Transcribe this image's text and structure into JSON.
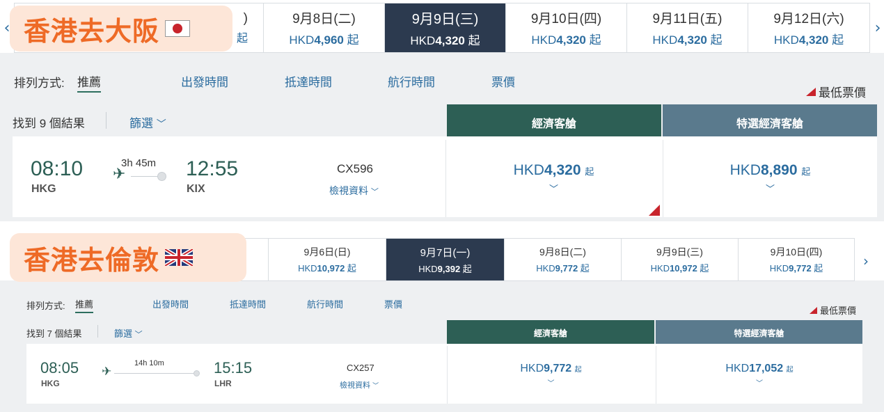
{
  "panel1": {
    "title": "香港去大阪",
    "flag_icon": "japan-flag-icon",
    "partial_date": ")",
    "partial_price": "起",
    "dates": [
      {
        "date": "9月8日(二)",
        "currency": "HKD",
        "price": "4,960",
        "suffix": " 起",
        "active": false
      },
      {
        "date": "9月9日(三)",
        "currency": "HKD",
        "price": "4,320",
        "suffix": " 起",
        "active": true
      },
      {
        "date": "9月10日(四)",
        "currency": "HKD",
        "price": "4,320",
        "suffix": " 起",
        "active": false
      },
      {
        "date": "9月11日(五)",
        "currency": "HKD",
        "price": "4,320",
        "suffix": " 起",
        "active": false
      },
      {
        "date": "9月12日(六)",
        "currency": "HKD",
        "price": "4,320",
        "suffix": " 起",
        "active": false
      }
    ],
    "sort_label": "排列方式:",
    "sort_current": "推薦",
    "sort_options": [
      "出發時間",
      "抵達時間",
      "航行時間",
      "票價"
    ],
    "lowest_fare": "最低票價",
    "results": "找到 9 個結果",
    "filter": "篩選",
    "cabin_economy": "經濟客艙",
    "cabin_premium": "特選經濟客艙",
    "flight": {
      "depart_time": "08:10",
      "depart_code": "HKG",
      "duration": "3h 45m",
      "arrive_time": "12:55",
      "arrive_code": "KIX",
      "number": "CX596",
      "details": "檢視資料",
      "economy_currency": "HKD",
      "economy_price": "4,320",
      "premium_currency": "HKD",
      "premium_price": "8,890",
      "price_suffix": "起"
    }
  },
  "panel2": {
    "title": "香港去倫敦",
    "flag_icon": "uk-flag-icon",
    "dates": [
      {
        "date": "9月6日(日)",
        "currency": "HKD",
        "price": "10,972",
        "suffix": " 起",
        "active": false
      },
      {
        "date": "9月7日(一)",
        "currency": "HKD",
        "price": "9,392",
        "suffix": " 起",
        "active": true
      },
      {
        "date": "9月8日(二)",
        "currency": "HKD",
        "price": "9,772",
        "suffix": " 起",
        "active": false
      },
      {
        "date": "9月9日(三)",
        "currency": "HKD",
        "price": "10,972",
        "suffix": " 起",
        "active": false
      },
      {
        "date": "9月10日(四)",
        "currency": "HKD",
        "price": "9,772",
        "suffix": " 起",
        "active": false
      }
    ],
    "sort_label": "排列方式:",
    "sort_current": "推薦",
    "sort_options": [
      "出發時間",
      "抵達時間",
      "航行時間",
      "票價"
    ],
    "lowest_fare": "最低票價",
    "results": "找到 7 個結果",
    "filter": "篩選",
    "cabin_economy": "經濟客艙",
    "cabin_premium": "特選經濟客艙",
    "flight": {
      "depart_time": "08:05",
      "depart_code": "HKG",
      "duration": "14h 10m",
      "arrive_time": "15:15",
      "arrive_code": "LHR",
      "number": "CX257",
      "details": "檢視資料",
      "economy_currency": "HKD",
      "economy_price": "9,772",
      "premium_currency": "HKD",
      "premium_price": "17,052",
      "price_suffix": "起"
    }
  },
  "colors": {
    "accent_orange": "#ee6a26",
    "badge_bg": "#fde6d8",
    "active_date": "#2c3a4f",
    "economy": "#2d5f55",
    "premium": "#5a7a8d",
    "link_blue": "#2b6c9f",
    "lowest_red": "#c8242c"
  }
}
